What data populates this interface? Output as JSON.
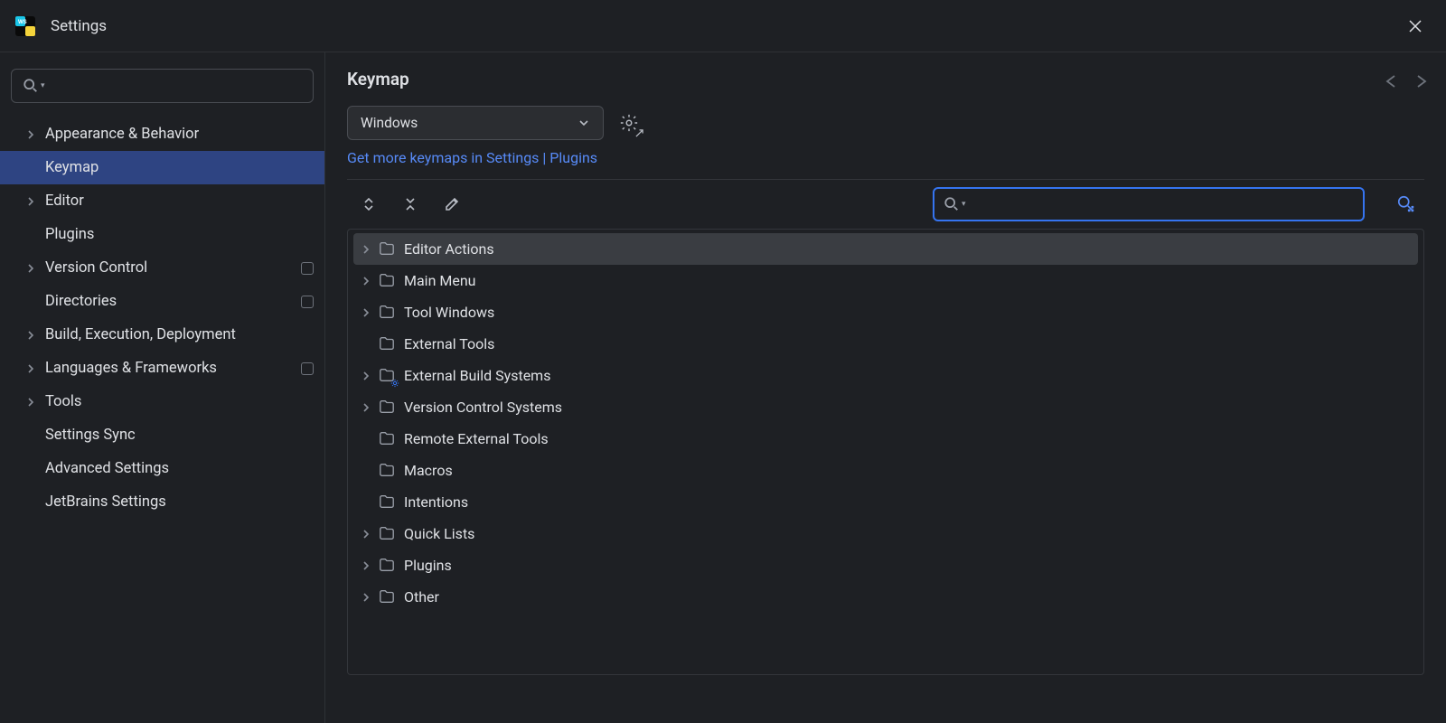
{
  "window": {
    "title": "Settings"
  },
  "sidebar": {
    "search_placeholder": "",
    "items": [
      {
        "label": "Appearance & Behavior",
        "expandable": true,
        "active": false,
        "badge": false
      },
      {
        "label": "Keymap",
        "expandable": false,
        "active": true,
        "badge": false
      },
      {
        "label": "Editor",
        "expandable": true,
        "active": false,
        "badge": false
      },
      {
        "label": "Plugins",
        "expandable": false,
        "active": false,
        "badge": false
      },
      {
        "label": "Version Control",
        "expandable": true,
        "active": false,
        "badge": true
      },
      {
        "label": "Directories",
        "expandable": false,
        "active": false,
        "badge": true
      },
      {
        "label": "Build, Execution, Deployment",
        "expandable": true,
        "active": false,
        "badge": false
      },
      {
        "label": "Languages & Frameworks",
        "expandable": true,
        "active": false,
        "badge": true
      },
      {
        "label": "Tools",
        "expandable": true,
        "active": false,
        "badge": false
      },
      {
        "label": "Settings Sync",
        "expandable": false,
        "active": false,
        "badge": false
      },
      {
        "label": "Advanced Settings",
        "expandable": false,
        "active": false,
        "badge": false
      },
      {
        "label": "JetBrains Settings",
        "expandable": false,
        "active": false,
        "badge": false
      }
    ]
  },
  "main": {
    "title": "Keymap",
    "keymap_selected": "Windows",
    "link_text": "Get more keymaps in Settings | Plugins",
    "action_search_placeholder": "",
    "groups": [
      {
        "label": "Editor Actions",
        "expandable": true,
        "highlighted": true,
        "gear": false
      },
      {
        "label": "Main Menu",
        "expandable": true,
        "highlighted": false,
        "gear": false
      },
      {
        "label": "Tool Windows",
        "expandable": true,
        "highlighted": false,
        "gear": false
      },
      {
        "label": "External Tools",
        "expandable": false,
        "highlighted": false,
        "gear": false
      },
      {
        "label": "External Build Systems",
        "expandable": true,
        "highlighted": false,
        "gear": true
      },
      {
        "label": "Version Control Systems",
        "expandable": true,
        "highlighted": false,
        "gear": false
      },
      {
        "label": "Remote External Tools",
        "expandable": false,
        "highlighted": false,
        "gear": false
      },
      {
        "label": "Macros",
        "expandable": false,
        "highlighted": false,
        "gear": false
      },
      {
        "label": "Intentions",
        "expandable": false,
        "highlighted": false,
        "gear": false
      },
      {
        "label": "Quick Lists",
        "expandable": true,
        "highlighted": false,
        "gear": false
      },
      {
        "label": "Plugins",
        "expandable": true,
        "highlighted": false,
        "gear": false
      },
      {
        "label": "Other",
        "expandable": true,
        "highlighted": false,
        "gear": false
      }
    ]
  }
}
